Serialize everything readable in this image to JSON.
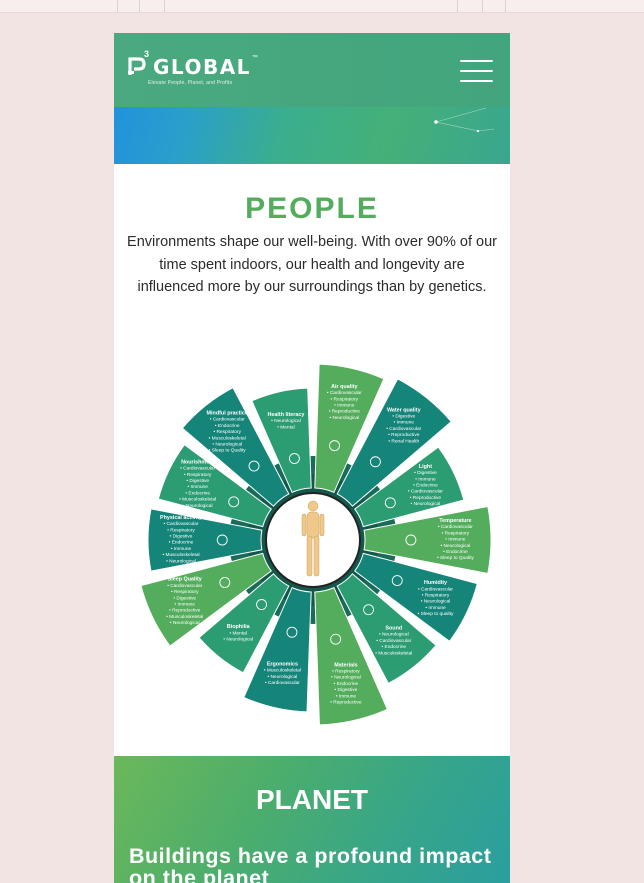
{
  "brand": {
    "name": "GLOBAL",
    "superscript": "3",
    "trademark": "™",
    "tagline": "Elevate People, Planet, and Profits",
    "colors": {
      "green": "#53ad5c",
      "teal": "#15857a",
      "blue": "#1f8fe0"
    }
  },
  "nav": {
    "menu_icon": "hamburger-menu-icon"
  },
  "people": {
    "title": "PEOPLE",
    "description": "Environments shape our well-being. With over 90% of our time spent indoors, our health and longevity are influenced more by our surroundings than by genetics."
  },
  "wellness_wheel": {
    "segments": [
      {
        "title": "Air quality",
        "items": [
          "Cardiovascular",
          "Respiratory",
          "Immune",
          "Reproductive",
          "Neurological"
        ],
        "icon": "air-wind-icon",
        "color": "#53ad5c"
      },
      {
        "title": "Water quality",
        "items": [
          "Digestive",
          "Immune",
          "Cardiovascular",
          "Reproductive",
          "Renal Health"
        ],
        "icon": "water-drop-icon",
        "color": "#15857a"
      },
      {
        "title": "Light",
        "items": [
          "Digestive",
          "Immune",
          "Endocrine",
          "Cardiovascular",
          "Reproductive",
          "Neurological"
        ],
        "icon": "light-bulb-icon",
        "color": "#2c9c73"
      },
      {
        "title": "Temperature",
        "items": [
          "Cardiovascular",
          "Respiratory",
          "Immune",
          "Neurological",
          "Endocrine",
          "Sleep to Quality"
        ],
        "icon": "thermometer-icon",
        "color": "#53ad5c"
      },
      {
        "title": "Humidity",
        "items": [
          "Cardiovascular",
          "Respiratory",
          "Neurological",
          "Immune",
          "Sleep to quality"
        ],
        "icon": "humidity-icon",
        "color": "#15857a"
      },
      {
        "title": "Sound",
        "items": [
          "Neurological",
          "Cardiovascular",
          "Endocrine",
          "Musculoskeletal"
        ],
        "icon": "speaker-icon",
        "color": "#2c9c73"
      },
      {
        "title": "Materials",
        "items": [
          "Respiratory",
          "Neurological",
          "Endocrine",
          "Digestive",
          "Immune",
          "Reproductive"
        ],
        "icon": "materials-icon",
        "color": "#53ad5c"
      },
      {
        "title": "Ergonomics",
        "items": [
          "Musculoskeletal",
          "Neurological",
          "Cardiovascular"
        ],
        "icon": "ergonomics-icon",
        "color": "#15857a"
      },
      {
        "title": "Biophilia",
        "items": [
          "Mental",
          "Neurological"
        ],
        "icon": "plant-icon",
        "color": "#2c9c73"
      },
      {
        "title": "Sleep Quality",
        "items": [
          "Cardiovascular",
          "Respiratory",
          "Digestive",
          "Immune",
          "Reproductive",
          "Musculoskeletal",
          "Neurological"
        ],
        "icon": "sleep-moon-icon",
        "color": "#53ad5c"
      },
      {
        "title": "Physical activity",
        "items": [
          "Cardiovascular",
          "Respiratory",
          "Digestive",
          "Endocrine",
          "Immune",
          "Musculoskeletal",
          "Neurological"
        ],
        "icon": "running-icon",
        "color": "#15857a"
      },
      {
        "title": "Nourishment",
        "items": [
          "Cardiovascular",
          "Respiratory",
          "Digestive",
          "Immune",
          "Endocrine",
          "Musculoskeletal",
          "Neurological"
        ],
        "icon": "nourishment-icon",
        "color": "#2c9c73"
      },
      {
        "title": "Mindful practice",
        "items": [
          "Cardiovascular",
          "Endocrine",
          "Respiratory",
          "Musculoskeletal",
          "Neurological",
          "Sleep to Quality"
        ],
        "icon": "meditation-icon",
        "color": "#15857a"
      },
      {
        "title": "Health literacy",
        "items": [
          "Neurological",
          "Mental"
        ],
        "icon": "book-icon",
        "color": "#2c9c73"
      }
    ]
  },
  "planet": {
    "title": "PLANET",
    "subtitle": "Buildings have a profound impact on the planet"
  }
}
